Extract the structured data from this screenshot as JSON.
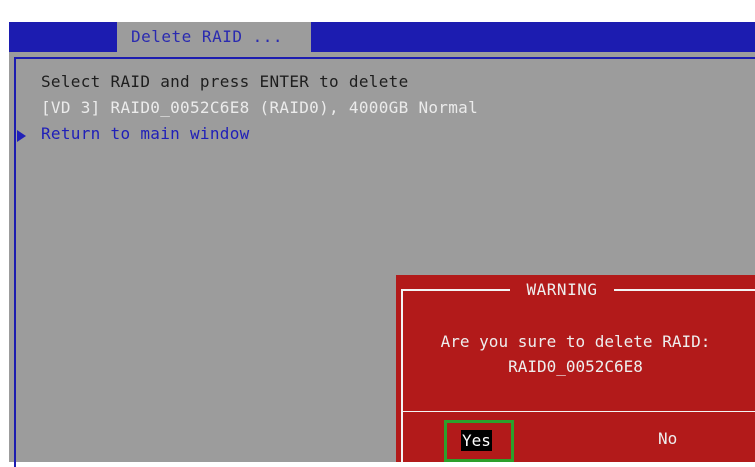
{
  "window": {
    "title": "Delete RAID ..."
  },
  "content": {
    "instruction": "Select RAID and press ENTER to delete",
    "raid_entry": "[VD 3] RAID0_0052C6E8 (RAID0), 4000GB Normal",
    "return_label": "Return to main window"
  },
  "dialog": {
    "title": "WARNING",
    "message_line1": "Are you sure to delete RAID:",
    "message_line2": "RAID0_0052C6E8",
    "yes_label": "Yes",
    "no_label": "No"
  },
  "colors": {
    "header_blue": "#1c1cb0",
    "panel_gray": "#9c9c9c",
    "dialog_red": "#b21a1a",
    "focus_green": "#2ca02c"
  },
  "icons": {
    "pointer": "triangle-right-icon"
  }
}
